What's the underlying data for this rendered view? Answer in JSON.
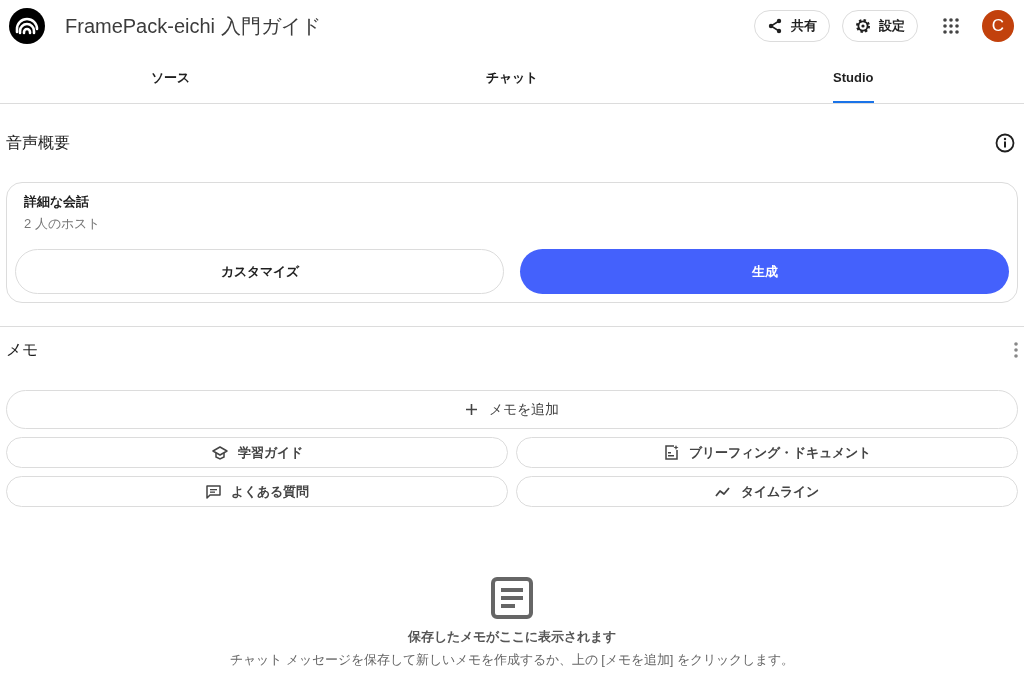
{
  "header": {
    "title": "FramePack-eichi 入門ガイド",
    "buttons": [
      {
        "kind": "share",
        "label": "共有"
      },
      {
        "kind": "settings",
        "label": "設定"
      }
    ],
    "avatar": "C"
  },
  "tabs": [
    {
      "label": "ソース",
      "selected": false
    },
    {
      "label": "チャット",
      "selected": false
    },
    {
      "label": "Studio",
      "selected": true
    }
  ],
  "audio_overview": {
    "title": "音声概要",
    "card": {
      "title": "詳細な会話",
      "subtitle": "2 人のホスト",
      "buttons": [
        {
          "label": "カスタマイズ",
          "primary": false
        },
        {
          "label": "生成",
          "primary": true
        }
      ]
    }
  },
  "notes": {
    "title": "メモ",
    "add_button": "メモを追加",
    "tools": [
      {
        "kind": "study",
        "label": "学習ガイド"
      },
      {
        "kind": "briefing",
        "label": "ブリーフィング・ドキュメント"
      },
      {
        "kind": "faq",
        "label": "よくある質問"
      },
      {
        "kind": "timeline",
        "label": "タイムライン"
      }
    ],
    "empty": {
      "title": "保存したメモがここに表示されます",
      "message": "チャット メッセージを保存して新しいメモを作成するか、上の [メモを追加] をクリックします。"
    }
  }
}
